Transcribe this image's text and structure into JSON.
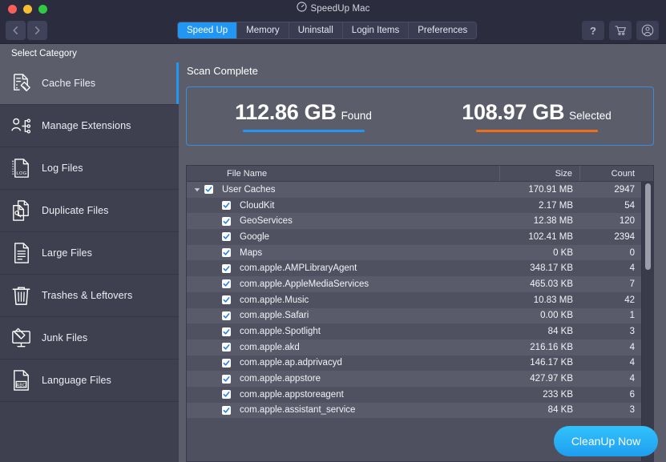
{
  "window": {
    "title": "SpeedUp Mac",
    "title_icon": "gauge-icon",
    "controls": {
      "close": "close",
      "minimize": "minimize",
      "zoom": "zoom"
    }
  },
  "toolbar": {
    "back_icon": "chevron-left-icon",
    "forward_icon": "chevron-right-icon",
    "tabs": [
      {
        "label": "Speed Up",
        "active": true
      },
      {
        "label": "Memory",
        "active": false
      },
      {
        "label": "Uninstall",
        "active": false
      },
      {
        "label": "Login Items",
        "active": false
      },
      {
        "label": "Preferences",
        "active": false
      }
    ],
    "right_buttons": [
      {
        "name": "help-button",
        "icon": "question-mark-icon",
        "label": "?"
      },
      {
        "name": "cart-button",
        "icon": "shopping-cart-icon",
        "label": ""
      },
      {
        "name": "account-button",
        "icon": "user-account-icon",
        "label": ""
      }
    ]
  },
  "sidebar": {
    "header": "Select Category",
    "items": [
      {
        "label": "Cache Files",
        "icon": "cache-files-icon",
        "selected": true
      },
      {
        "label": "Manage Extensions",
        "icon": "manage-extensions-icon",
        "selected": false
      },
      {
        "label": "Log Files",
        "icon": "log-files-icon",
        "selected": false
      },
      {
        "label": "Duplicate Files",
        "icon": "duplicate-files-icon",
        "selected": false
      },
      {
        "label": "Large Files",
        "icon": "large-files-icon",
        "selected": false
      },
      {
        "label": "Trashes & Leftovers",
        "icon": "trash-icon",
        "selected": false
      },
      {
        "label": "Junk Files",
        "icon": "junk-files-icon",
        "selected": false
      },
      {
        "label": "Language Files",
        "icon": "language-files-icon",
        "selected": false
      }
    ]
  },
  "main": {
    "status": "Scan Complete",
    "summary": [
      {
        "value": "112.86 GB",
        "label": "Found",
        "bar_color": "#2196f3"
      },
      {
        "value": "108.97 GB",
        "label": "Selected",
        "bar_color": "#f06d1c"
      }
    ],
    "table": {
      "columns": [
        "File Name",
        "Size",
        "Count"
      ],
      "rows": [
        {
          "name": "User Caches",
          "size": "170.91 MB",
          "count": "2947",
          "level": 0,
          "checked": true,
          "expanded": true
        },
        {
          "name": "CloudKit",
          "size": "2.17 MB",
          "count": "54",
          "level": 1,
          "checked": true
        },
        {
          "name": "GeoServices",
          "size": "12.38 MB",
          "count": "120",
          "level": 1,
          "checked": true
        },
        {
          "name": "Google",
          "size": "102.41 MB",
          "count": "2394",
          "level": 1,
          "checked": true
        },
        {
          "name": "Maps",
          "size": "0  KB",
          "count": "0",
          "level": 1,
          "checked": true
        },
        {
          "name": "com.apple.AMPLibraryAgent",
          "size": "348.17 KB",
          "count": "4",
          "level": 1,
          "checked": true
        },
        {
          "name": "com.apple.AppleMediaServices",
          "size": "465.03 KB",
          "count": "7",
          "level": 1,
          "checked": true
        },
        {
          "name": "com.apple.Music",
          "size": "10.83 MB",
          "count": "42",
          "level": 1,
          "checked": true
        },
        {
          "name": "com.apple.Safari",
          "size": "0.00 KB",
          "count": "1",
          "level": 1,
          "checked": true
        },
        {
          "name": "com.apple.Spotlight",
          "size": "84  KB",
          "count": "3",
          "level": 1,
          "checked": true
        },
        {
          "name": "com.apple.akd",
          "size": "216.16 KB",
          "count": "4",
          "level": 1,
          "checked": true
        },
        {
          "name": "com.apple.ap.adprivacyd",
          "size": "146.17 KB",
          "count": "4",
          "level": 1,
          "checked": true
        },
        {
          "name": "com.apple.appstore",
          "size": "427.97 KB",
          "count": "4",
          "level": 1,
          "checked": true
        },
        {
          "name": "com.apple.appstoreagent",
          "size": "233  KB",
          "count": "6",
          "level": 1,
          "checked": true
        },
        {
          "name": "com.apple.assistant_service",
          "size": "84  KB",
          "count": "3",
          "level": 1,
          "checked": true
        }
      ]
    },
    "cleanup_button": "CleanUp Now"
  },
  "colors": {
    "accent_blue": "#2196f3",
    "accent_orange": "#f06d1c",
    "titlebar": "#2b2d3e",
    "sidebar": "#3e4050",
    "content": "#5b5d6b"
  }
}
